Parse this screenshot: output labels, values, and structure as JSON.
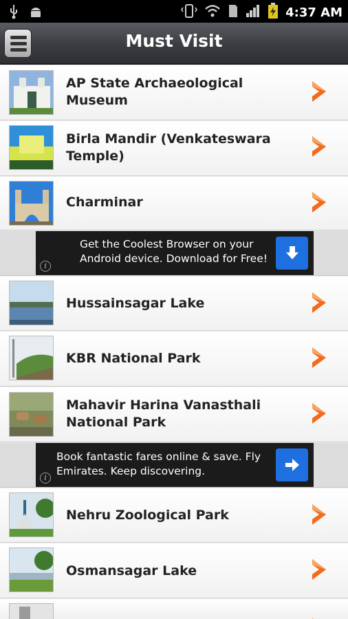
{
  "status_bar": {
    "time": "4:37 AM",
    "icons": [
      "usb-icon",
      "android-debug-icon",
      "vibrate-icon",
      "wifi-icon",
      "sd-card-icon",
      "signal-icon",
      "battery-charging-icon"
    ]
  },
  "header": {
    "title": "Must Visit",
    "menu_icon": "menu-icon"
  },
  "places": [
    {
      "label": "AP State Archaeological Museum",
      "icon": "chevron-right-icon"
    },
    {
      "label": "Birla Mandir (Venkateswara Temple)",
      "icon": "chevron-right-icon"
    },
    {
      "label": "Charminar",
      "icon": "chevron-right-icon"
    },
    {
      "label": "Hussainsagar Lake",
      "icon": "chevron-right-icon"
    },
    {
      "label": "KBR National Park",
      "icon": "chevron-right-icon"
    },
    {
      "label": "Mahavir Harina Vanasthali National Park",
      "icon": "chevron-right-icon"
    },
    {
      "label": "Nehru Zoological Park",
      "icon": "chevron-right-icon"
    },
    {
      "label": "Osmansagar Lake",
      "icon": "chevron-right-icon"
    }
  ],
  "ads": [
    {
      "text": "Get the Coolest Browser on your Android device. Download for Free!",
      "icon": "download-arrow-icon"
    },
    {
      "text": "Book fantastic fares online & save. Fly Emirates. Keep discovering.",
      "icon": "right-arrow-icon"
    }
  ],
  "colors": {
    "accent_orange": "#f26a1b",
    "ad_button_blue": "#1e6fe0",
    "titlebar": "#3a3c41"
  }
}
